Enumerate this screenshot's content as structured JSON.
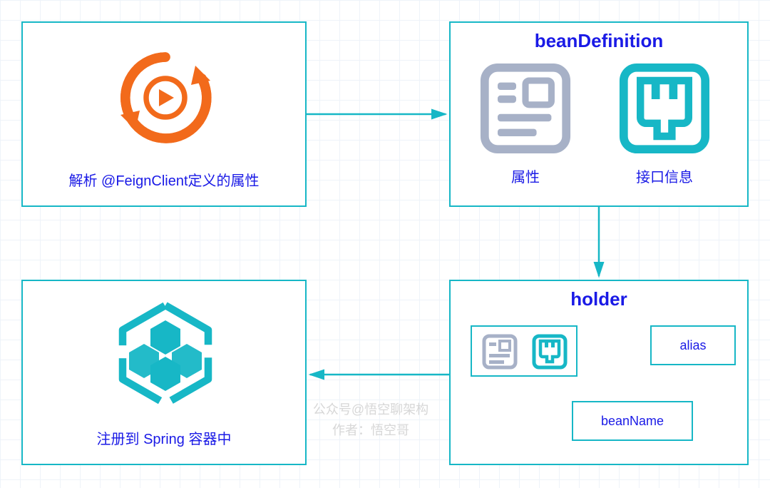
{
  "boxes": {
    "topLeft": {
      "caption": "解析 @FeignClient定义的属性"
    },
    "topRight": {
      "title": "beanDefinition",
      "left_caption": "属性",
      "right_caption": "接口信息"
    },
    "bottomRight": {
      "title": "holder",
      "alias": "alias",
      "beanName": "beanName"
    },
    "bottomLeft": {
      "caption": "注册到 Spring 容器中"
    }
  },
  "watermark": {
    "line1": "公众号@悟空聊架构",
    "line2": "作者：悟空哥"
  },
  "colors": {
    "border": "#17b7c6",
    "title": "#1a1ae6",
    "orange": "#f26a1b",
    "gray": "#a7b1c7"
  }
}
